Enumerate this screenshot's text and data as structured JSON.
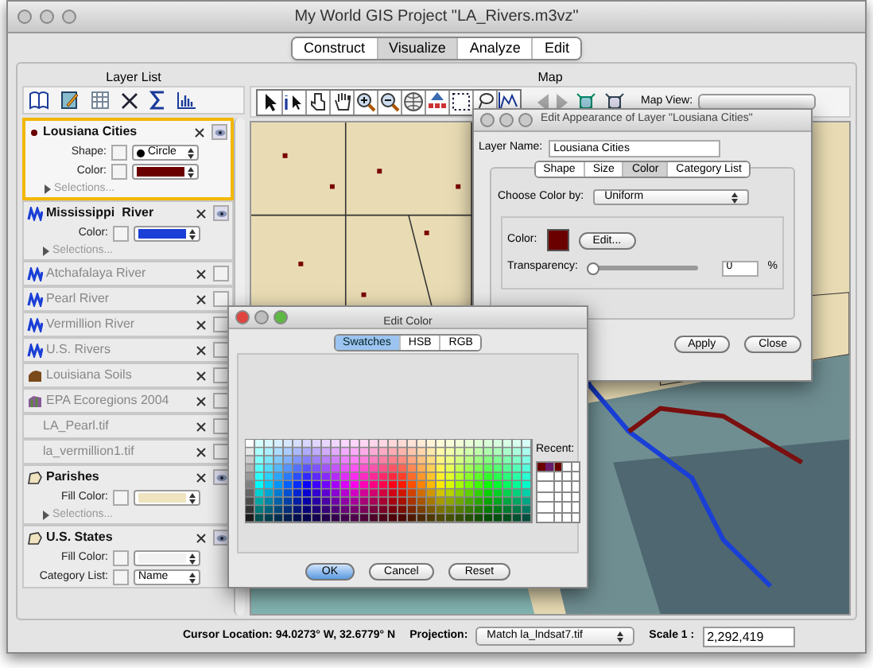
{
  "window": {
    "title": "My World GIS Project \"LA_Rivers.m3vz\""
  },
  "mode_tabs": [
    {
      "label": "Construct",
      "selected": false
    },
    {
      "label": "Visualize",
      "selected": true
    },
    {
      "label": "Analyze",
      "selected": false
    },
    {
      "label": "Edit",
      "selected": false
    }
  ],
  "layer_list": {
    "title": "Layer List",
    "layers": [
      {
        "name": "Lousiana Cities",
        "kind": "point",
        "selected": true,
        "visible": true,
        "properties": [
          {
            "label": "Shape:",
            "kind": "shape",
            "value": "Circle"
          },
          {
            "label": "Color:",
            "kind": "color",
            "color": "#6b0000"
          }
        ],
        "selections": "Selections..."
      },
      {
        "name": "Mississippi  River",
        "kind": "line",
        "selected": false,
        "visible": true,
        "properties": [
          {
            "label": "Color:",
            "kind": "color",
            "color": "#1a3fd6"
          }
        ],
        "selections": "Selections..."
      },
      {
        "name": "Atchafalaya River",
        "kind": "line",
        "selected": false,
        "visible": false
      },
      {
        "name": "Pearl River",
        "kind": "line",
        "selected": false,
        "visible": false
      },
      {
        "name": "Vermillion River",
        "kind": "line",
        "selected": false,
        "visible": false
      },
      {
        "name": "U.S. Rivers",
        "kind": "line",
        "selected": false,
        "visible": false
      },
      {
        "name": "Louisiana Soils",
        "kind": "soil",
        "selected": false,
        "visible": false
      },
      {
        "name": "EPA Ecoregions 2004",
        "kind": "eco",
        "selected": false,
        "visible": false
      },
      {
        "name": "LA_Pearl.tif",
        "selected": false,
        "visible": false
      },
      {
        "name": "la_vermillion1.tif",
        "selected": false,
        "visible": false
      },
      {
        "name": "Parishes",
        "kind": "polygon",
        "selected": false,
        "visible": true,
        "properties": [
          {
            "label": "Fill Color:",
            "kind": "color",
            "color": "#efe3c0"
          }
        ],
        "selections": "Selections..."
      },
      {
        "name": "U.S. States",
        "kind": "polygon",
        "selected": false,
        "visible": true,
        "properties": [
          {
            "label": "Fill Color:",
            "kind": "color",
            "color": "#f2f2f2"
          },
          {
            "label": "Category List:",
            "kind": "select",
            "value": "Name"
          }
        ]
      }
    ]
  },
  "map": {
    "title": "Map",
    "map_view_label": "Map View:"
  },
  "appearance_dialog": {
    "title": "Edit Appearance of Layer \"Lousiana Cities\"",
    "layer_name_label": "Layer Name:",
    "layer_name": "Lousiana Cities",
    "tabs": [
      {
        "label": "Shape",
        "selected": false
      },
      {
        "label": "Size",
        "selected": false
      },
      {
        "label": "Color",
        "selected": true
      },
      {
        "label": "Category List",
        "selected": false
      }
    ],
    "choose_color_by_label": "Choose Color by:",
    "choose_color_by": "Uniform",
    "color_label": "Color:",
    "color": "#6b0000",
    "edit_button": "Edit...",
    "transparency_label": "Transparency:",
    "transparency": {
      "level": 0
    },
    "transparency_value": "0",
    "percent": "%",
    "buttons": [
      "Apply",
      "Close"
    ]
  },
  "color_dialog": {
    "title": "Edit Color",
    "tabs": [
      {
        "label": "Swatches",
        "selected": true
      },
      {
        "label": "HSB",
        "selected": false
      },
      {
        "label": "RGB",
        "selected": false
      }
    ],
    "recent_label": "Recent:",
    "recent_colors": [
      {
        "color": "#6b0000"
      },
      {
        "color": "#6a1a6a"
      },
      {
        "color": "#6b0000"
      }
    ],
    "buttons": [
      {
        "label": "OK",
        "default": true
      },
      {
        "label": "Cancel",
        "default": false
      },
      {
        "label": "Reset",
        "default": false
      }
    ]
  },
  "status_bar": {
    "cursor_location": "Cursor Location: 94.0273° W, 32.6779° N",
    "projection_label": "Projection:",
    "projection": "Match la_lndsat7.tif",
    "scale_label": "Scale 1 :",
    "scale": "2,292,419"
  }
}
